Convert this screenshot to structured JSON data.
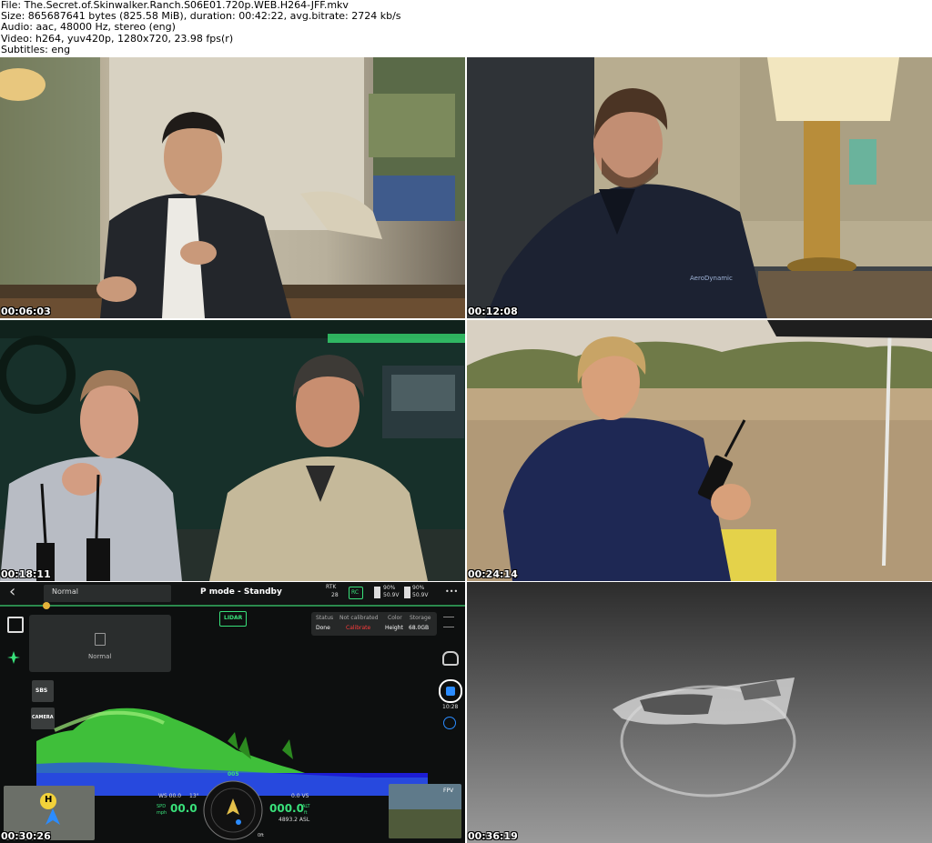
{
  "info": {
    "file": "File: The.Secret.of.Skinwalker.Ranch.S06E01.720p.WEB.H264-JFF.mkv",
    "size": "Size: 865687641 bytes (825.58 MiB), duration: 00:42:22, avg.bitrate: 2724 kb/s",
    "audio": "Audio: aac, 48000 Hz, stereo (eng)",
    "video": "Video: h264, yuv420p, 1280x720, 23.98 fps(r)",
    "subtitles": "Subtitles: eng"
  },
  "frames": [
    {
      "timestamp": "00:06:03"
    },
    {
      "timestamp": "00:12:08",
      "shirt_logo": "AeroDynamic"
    },
    {
      "timestamp": "00:18:11"
    },
    {
      "timestamp": "00:24:14"
    },
    {
      "timestamp": "00:30:26"
    },
    {
      "timestamp": "00:36:19"
    }
  ],
  "drone_ui": {
    "back": "‹",
    "mode_dropdown": "Normal",
    "mode_status": "P mode - Standby",
    "rtk_label": "RTK",
    "rtk_count": "28",
    "rc_label": "RC",
    "batt1_pct": "90%",
    "batt1_volt": "50.9V",
    "batt2_pct": "90%",
    "batt2_volt": "50.9V",
    "more": "•••",
    "lidar_button": "LIDAR",
    "status_label": "Status",
    "status_value": "Done",
    "calib_label": "Not calibrated",
    "calib_value": "Calibrate",
    "color_label": "Color",
    "color_value": "Height",
    "storage_label": "Storage",
    "storage_value": "68.0GB",
    "panel_label": "Normal",
    "sbs_button": "SBS",
    "camera_button": "CAMERA",
    "rec_time": "10:28",
    "ws_label": "WS 00.0",
    "ws_deg": "13°",
    "speed_unit_top": "SPD",
    "speed_unit_bot": "mph",
    "speed_value": "00.0",
    "heading": "005",
    "vs_value": "0.0 VS",
    "alt_value": "000.0",
    "alt_unit_top": "ALT",
    "alt_unit_bot": "ft",
    "asl_value": "4893.2 ASL",
    "bottom_mark": "0ft",
    "home_marker": "H",
    "fpv_label": "FPV",
    "accent_color": "#39e07a",
    "warning_color": "#ff3b3b"
  }
}
